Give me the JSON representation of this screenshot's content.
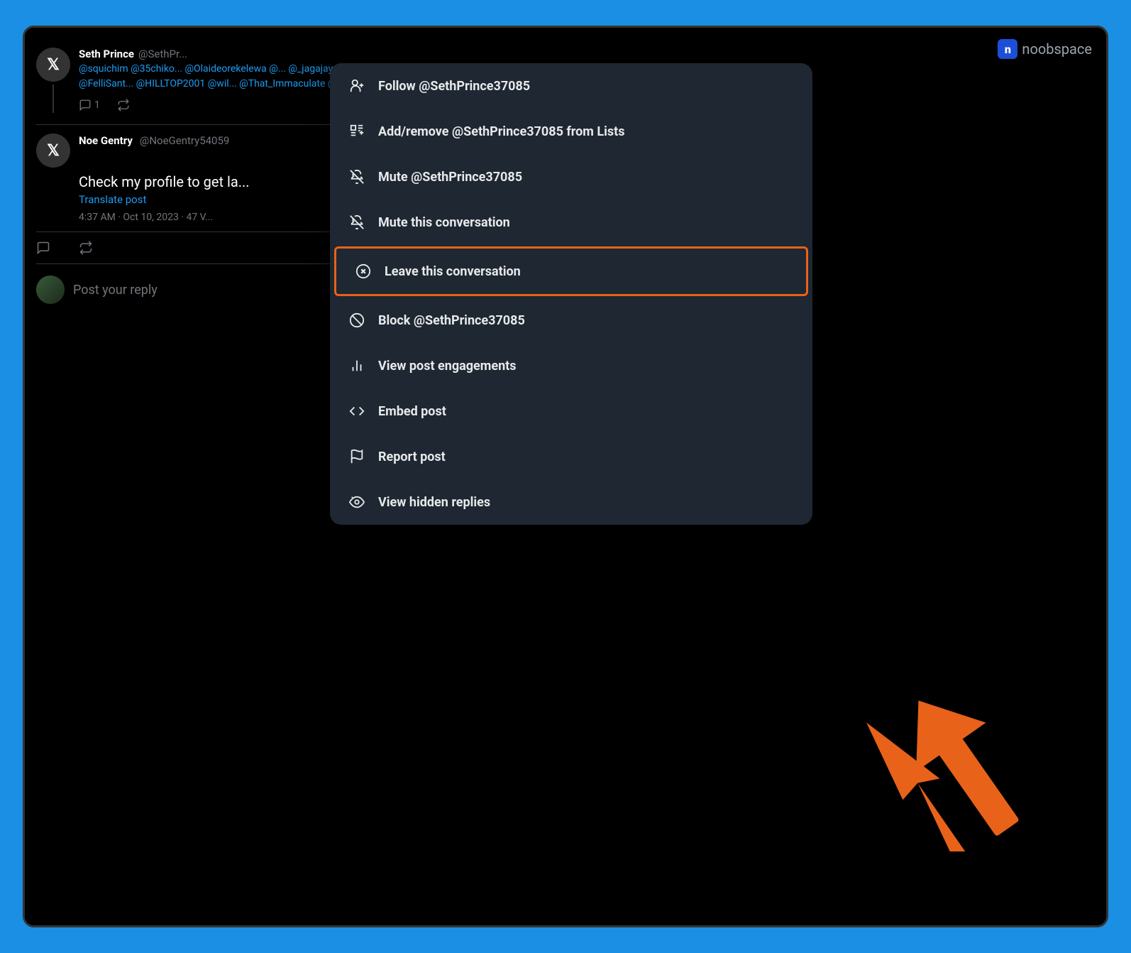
{
  "watermark": {
    "icon": "n",
    "text": "noobspace"
  },
  "tweet1": {
    "author_name": "Seth Prince",
    "author_handle": "@SethPr...",
    "mentions": "@squichim @35chiko... @Olaideorekelewa @... @_jagajay @FelliSant... @HILLTOP2001 @wil... @That_Immaculate @...",
    "reply_count": "1"
  },
  "tweet2": {
    "author_name": "Noe Gentry",
    "author_handle": "@NoeGentry54059",
    "text": "Check my profile to get la...",
    "translate_label": "Translate post",
    "meta": "4:37 AM · Oct 10, 2023 · 47 V..."
  },
  "reply_input": {
    "placeholder": "Post your reply"
  },
  "menu": {
    "items": [
      {
        "id": "follow",
        "label": "Follow @SethPrince37085",
        "icon": "follow"
      },
      {
        "id": "add-remove-list",
        "label": "Add/remove @SethPrince37085 from Lists",
        "icon": "list"
      },
      {
        "id": "mute-user",
        "label": "Mute @SethPrince37085",
        "icon": "mute"
      },
      {
        "id": "mute-conversation",
        "label": "Mute this conversation",
        "icon": "mute-convo"
      },
      {
        "id": "leave-conversation",
        "label": "Leave this conversation",
        "icon": "leave",
        "highlighted": true
      },
      {
        "id": "block",
        "label": "Block @SethPrince37085",
        "icon": "block"
      },
      {
        "id": "view-engagements",
        "label": "View post engagements",
        "icon": "chart"
      },
      {
        "id": "embed-post",
        "label": "Embed post",
        "icon": "embed"
      },
      {
        "id": "report-post",
        "label": "Report post",
        "icon": "flag"
      },
      {
        "id": "view-hidden-replies",
        "label": "View hidden replies",
        "icon": "hidden"
      }
    ]
  }
}
